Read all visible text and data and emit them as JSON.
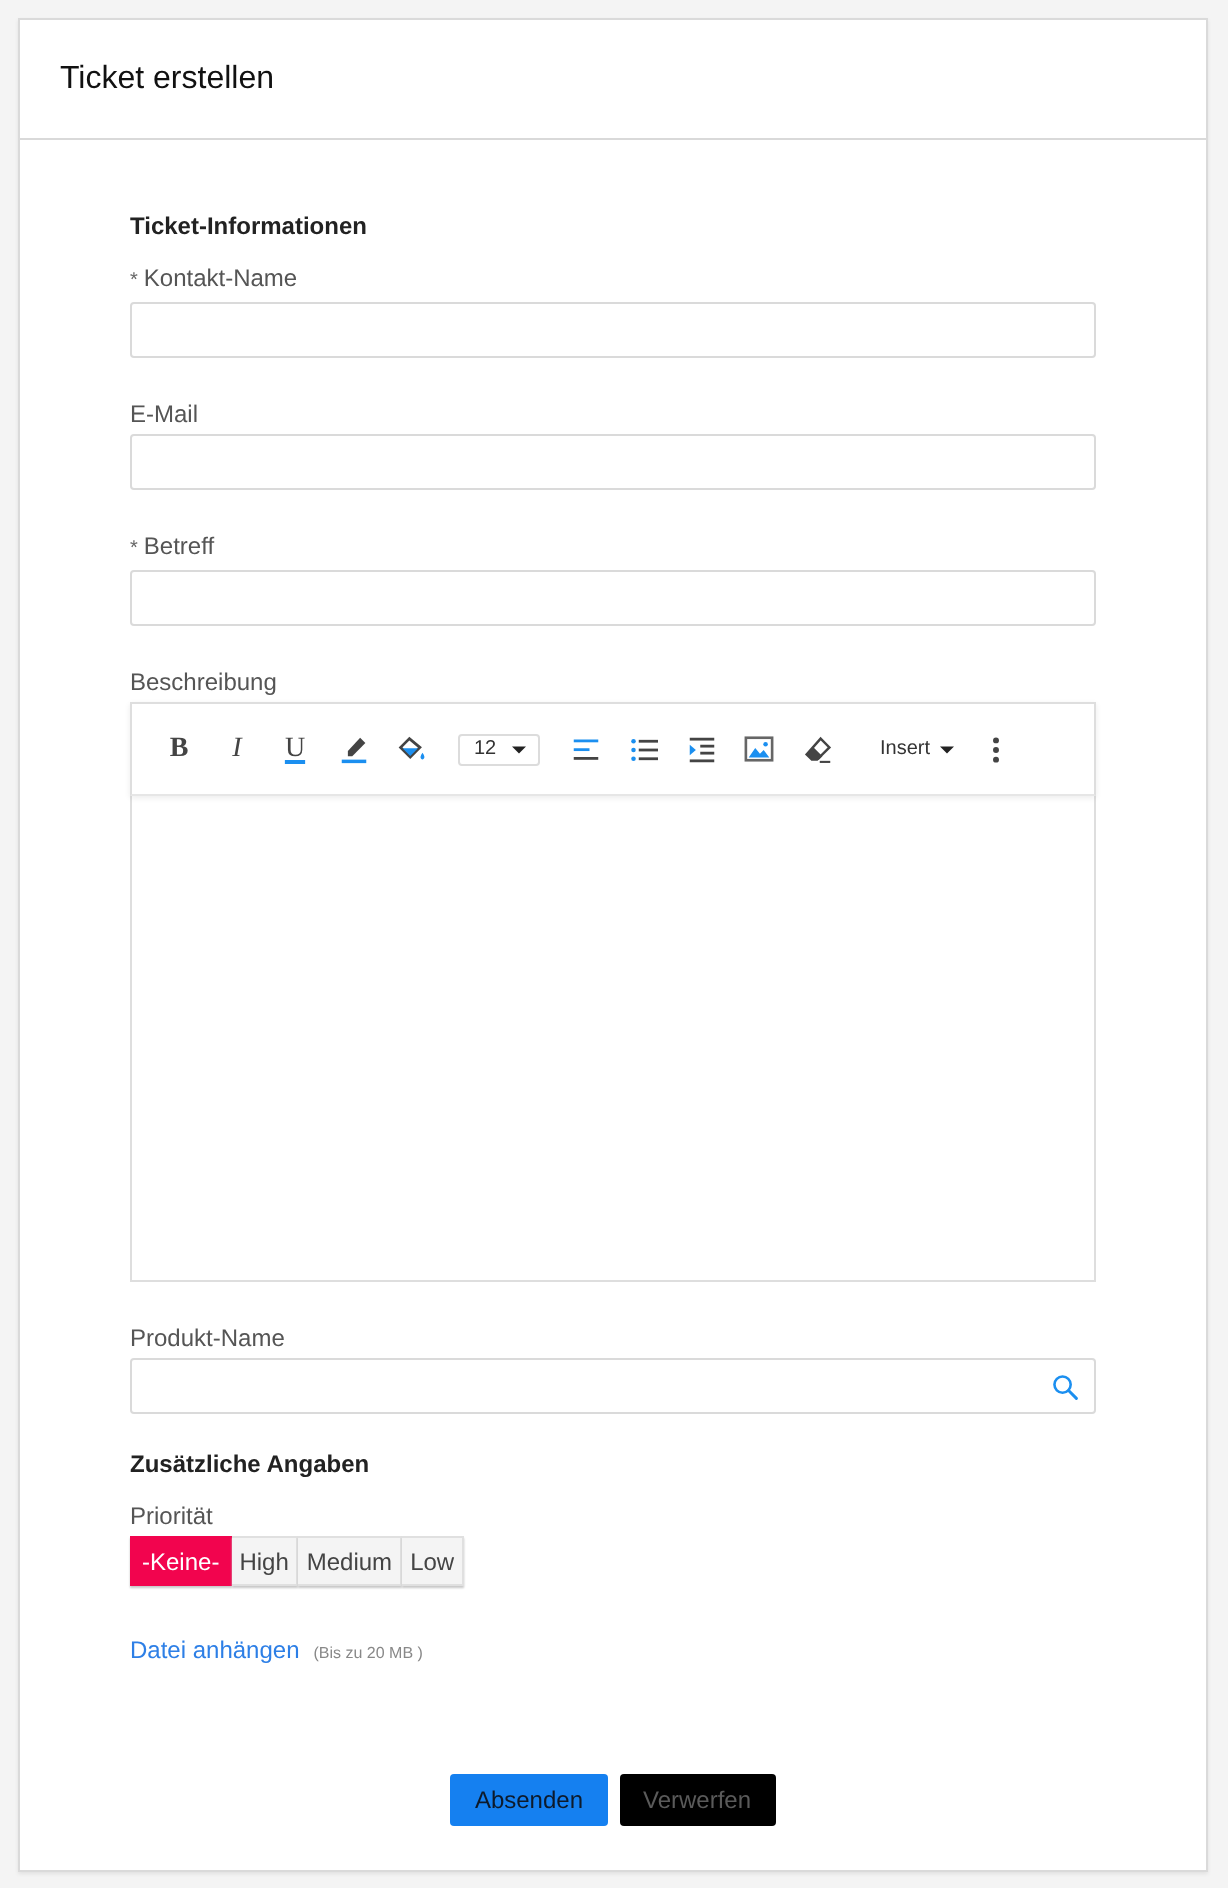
{
  "header": {
    "title": "Ticket erstellen"
  },
  "sections": [
    {
      "heading": "Ticket-Informationen",
      "fields": [
        {
          "kind": "text",
          "mark": "*",
          "label": "Kontakt-Name"
        },
        {
          "kind": "text",
          "label": "E-Mail"
        },
        {
          "kind": "text",
          "mark": "*",
          "label": "Betreff"
        },
        {
          "kind": "editor",
          "label": "Beschreibung",
          "toolbar": [
            {
              "kind": "bold",
              "text": "B"
            },
            {
              "kind": "italic",
              "text": "I"
            },
            {
              "kind": "underline",
              "text": "U"
            },
            {
              "kind": "text-color"
            },
            {
              "kind": "fill-color"
            },
            {
              "kind": "size",
              "text": "12"
            },
            {
              "kind": "align"
            },
            {
              "kind": "bullets"
            },
            {
              "kind": "indent"
            },
            {
              "kind": "image"
            },
            {
              "kind": "eraser"
            },
            {
              "kind": "menu",
              "text": "Insert"
            },
            {
              "kind": "more"
            }
          ]
        },
        {
          "kind": "lookup",
          "label": "Produkt-Name"
        }
      ]
    },
    {
      "heading": "Zusätzliche Angaben",
      "fields": [
        {
          "kind": "segmented",
          "label": "Priorität",
          "options": [
            {
              "label": "-Keine-",
              "selected": true
            },
            {
              "label": "High",
              "selected": false
            },
            {
              "label": "Medium",
              "selected": false
            },
            {
              "label": "Low",
              "selected": false
            }
          ]
        }
      ]
    }
  ],
  "attachment": {
    "link": "Datei anhängen",
    "note": "(Bis zu 20 MB )"
  },
  "buttons": [
    {
      "kind": "primary",
      "label": "Absenden"
    },
    {
      "kind": "secondary",
      "label": "Verwerfen"
    }
  ]
}
